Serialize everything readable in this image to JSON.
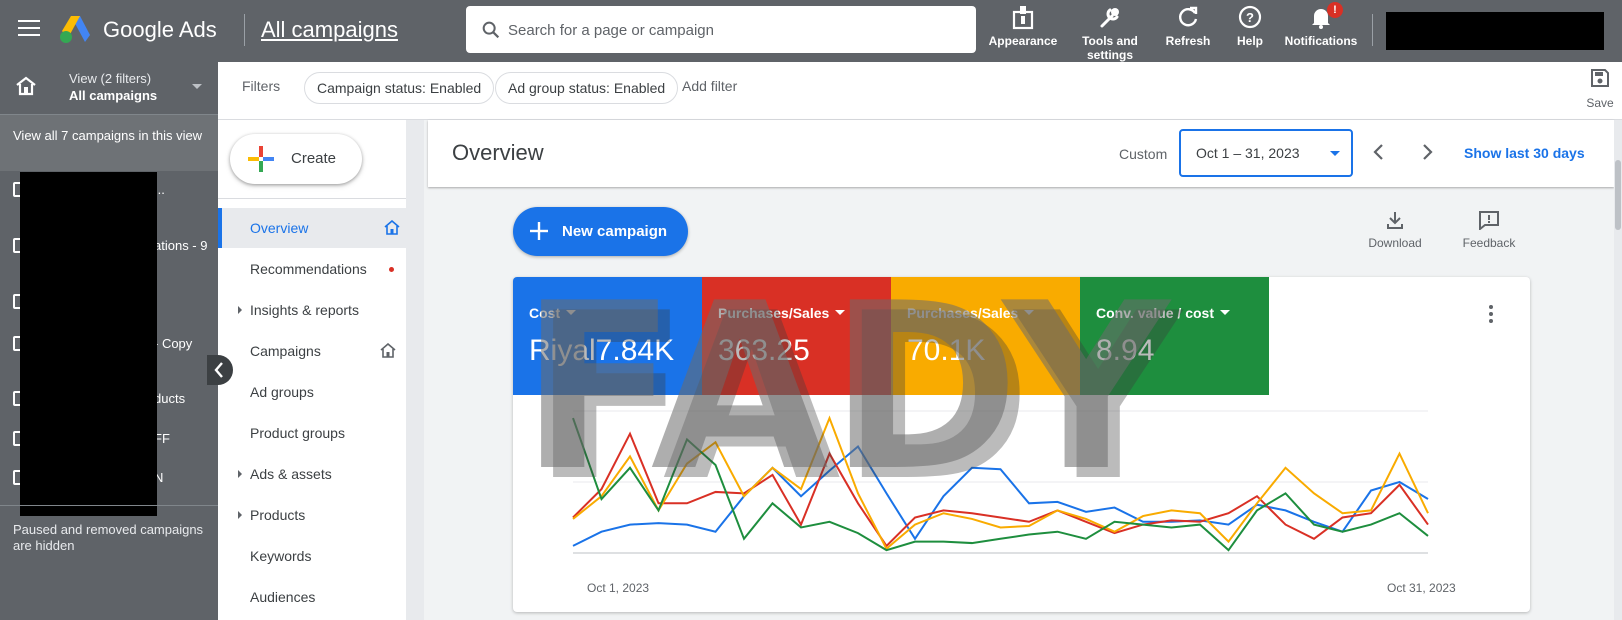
{
  "topbar": {
    "app_name": "Google Ads",
    "page_name": "All campaigns",
    "search_placeholder": "Search for a page or campaign",
    "tools": [
      {
        "label": "Appearance"
      },
      {
        "label": "Tools and settings"
      },
      {
        "label": "Refresh"
      },
      {
        "label": "Help"
      },
      {
        "label": "Notifications",
        "badge": "!"
      }
    ]
  },
  "leftbar": {
    "view_label": "View (2 filters)",
    "view_value": "All campaigns",
    "all_campaigns_text": "View all 7 campaigns in this view",
    "campaigns": [
      {
        "text": "..."
      },
      {
        "text": "ations - 9"
      },
      {
        "text": ""
      },
      {
        "text": "- Copy"
      },
      {
        "text": "ducts"
      },
      {
        "text": "FF"
      },
      {
        "text": "N"
      }
    ],
    "hidden_note": "Paused and removed campaigns are hidden"
  },
  "filters": {
    "label": "Filters",
    "chips": [
      "Campaign status: Enabled",
      "Ad group status: Enabled"
    ],
    "add_filter": "Add filter",
    "save": "Save"
  },
  "nav": {
    "create": "Create",
    "items": [
      {
        "label": "Overview"
      },
      {
        "label": "Recommendations"
      },
      {
        "label": "Insights & reports"
      },
      {
        "label": "Campaigns"
      },
      {
        "label": "Ad groups"
      },
      {
        "label": "Product groups"
      },
      {
        "label": "Ads & assets"
      },
      {
        "label": "Products"
      },
      {
        "label": "Keywords"
      },
      {
        "label": "Audiences"
      }
    ]
  },
  "overview": {
    "title": "Overview",
    "custom_label": "Custom",
    "date_range": "Oct 1 – 31, 2023",
    "show_last": "Show last 30 days",
    "new_campaign": "New campaign",
    "download": "Download",
    "feedback": "Feedback"
  },
  "metrics": [
    {
      "label": "Cost",
      "value": "Riyal7.84K",
      "color": "#1a73e8"
    },
    {
      "label": "Purchases/Sales",
      "value": "363.25",
      "color": "#d93025"
    },
    {
      "label": "Purchases/Sales",
      "value": "70.1K",
      "color": "#f9ab00"
    },
    {
      "label": "Conv. value / cost",
      "value": "8.94",
      "color": "#1e8e3e"
    }
  ],
  "watermark": "FADY",
  "chart_data": {
    "type": "line",
    "x_start_label": "Oct 1, 2023",
    "x_end_label": "Oct 31, 2023",
    "x": [
      1,
      2,
      3,
      4,
      5,
      6,
      7,
      8,
      9,
      10,
      11,
      12,
      13,
      14,
      15,
      16,
      17,
      18,
      19,
      20,
      21,
      22,
      23,
      24,
      25,
      26,
      27,
      28,
      29,
      30,
      31
    ],
    "ylim": [
      0,
      100
    ],
    "grid": true,
    "series": [
      {
        "color": "#1a73e8",
        "values": [
          5,
          15,
          20,
          21,
          20,
          15,
          40,
          60,
          40,
          58,
          75,
          42,
          10,
          40,
          60,
          59,
          35,
          36,
          29,
          32,
          22,
          22,
          23,
          20,
          34,
          30,
          22,
          15,
          44,
          50,
          38
        ]
      },
      {
        "color": "#d93025",
        "values": [
          25,
          45,
          84,
          35,
          35,
          43,
          42,
          55,
          20,
          70,
          35,
          5,
          25,
          30,
          28,
          25,
          22,
          30,
          22,
          14,
          20,
          23,
          22,
          28,
          40,
          20,
          10,
          25,
          28,
          48,
          20
        ]
      },
      {
        "color": "#f9ab00",
        "values": [
          24,
          40,
          68,
          30,
          63,
          78,
          40,
          60,
          45,
          95,
          42,
          3,
          20,
          28,
          24,
          18,
          19,
          30,
          24,
          15,
          26,
          30,
          28,
          8,
          35,
          60,
          42,
          28,
          30,
          70,
          28
        ]
      },
      {
        "color": "#1e8e3e",
        "values": [
          95,
          38,
          60,
          30,
          80,
          62,
          10,
          35,
          18,
          22,
          14,
          2,
          8,
          8,
          7,
          10,
          13,
          15,
          10,
          22,
          20,
          18,
          20,
          2,
          30,
          42,
          20,
          15,
          20,
          28,
          12
        ]
      }
    ]
  }
}
